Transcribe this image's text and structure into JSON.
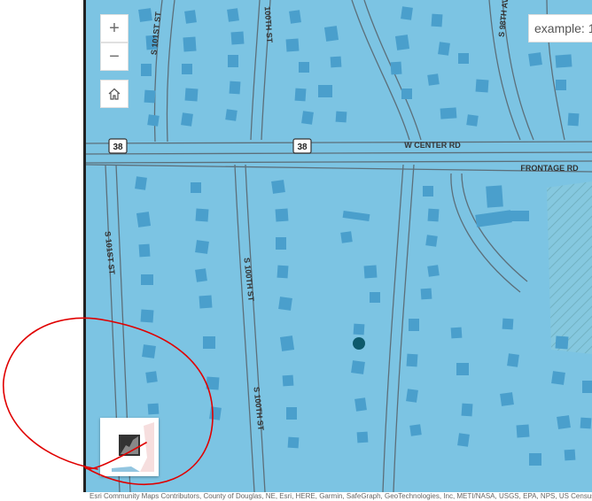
{
  "map": {
    "background_color": "#7cc4e3",
    "building_color": "#4a9fcc",
    "road_outline_color": "#5c6f7a",
    "marker_color": "#0d5a6c",
    "labels": {
      "s101st_top": "S 101ST ST",
      "100th_top": "100TH ST",
      "s98th_av": "S 98TH AV",
      "w_center_rd": "W CENTER RD",
      "frontage_rd": "FRONTAGE RD",
      "s101st_left": "S 101ST ST",
      "s100th_mid": "S 100TH ST",
      "s100th_bottom": "S 100TH ST"
    },
    "shields": {
      "left": "38",
      "center": "38"
    }
  },
  "controls": {
    "zoom_in": "+",
    "zoom_out": "−",
    "home_icon": "home-icon",
    "basemap_icon": "basemap-toggle-icon"
  },
  "search": {
    "placeholder": "example: 1"
  },
  "attribution": {
    "text": "Esri Community Maps Contributors, County of Douglas, NE, Esri, HERE, Garmin, SafeGraph, GeoTechnologies, Inc, METI/NASA, USGS, EPA, NPS, US Census Bureau, USDA"
  },
  "annotation": {
    "color": "#e00000"
  }
}
